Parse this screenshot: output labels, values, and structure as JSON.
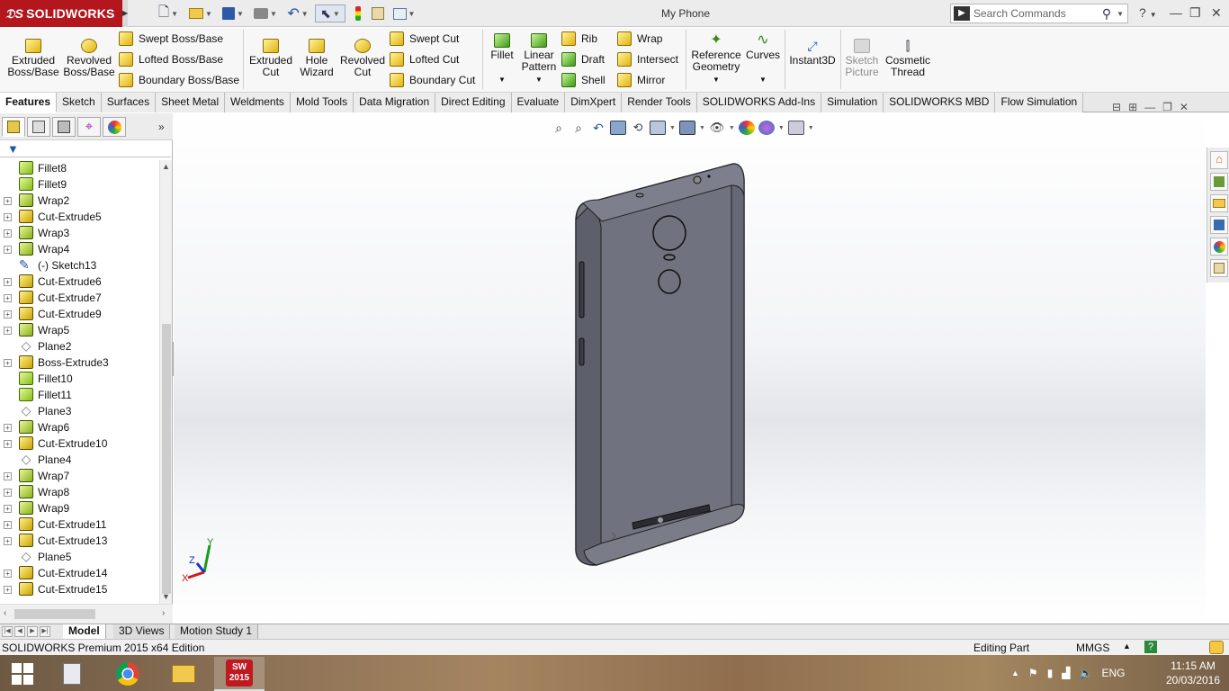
{
  "titlebar": {
    "app_name": "SOLIDWORKS",
    "doc_title": "My Phone",
    "search_placeholder": "Search Commands",
    "help_icon": "?"
  },
  "command_manager": {
    "large_buttons": [
      {
        "label": "Extruded Boss/Base"
      },
      {
        "label": "Revolved Boss/Base"
      },
      {
        "label": "Extruded Cut"
      },
      {
        "label": "Hole Wizard"
      },
      {
        "label": "Revolved Cut"
      },
      {
        "label": "Fillet"
      },
      {
        "label": "Linear Pattern"
      },
      {
        "label": "Reference Geometry"
      },
      {
        "label": "Curves"
      },
      {
        "label": "Instant3D"
      },
      {
        "label": "Sketch Picture"
      },
      {
        "label": "Cosmetic Thread"
      }
    ],
    "small_buttons": [
      {
        "label": "Swept Boss/Base"
      },
      {
        "label": "Lofted Boss/Base"
      },
      {
        "label": "Boundary Boss/Base"
      },
      {
        "label": "Swept Cut"
      },
      {
        "label": "Lofted Cut"
      },
      {
        "label": "Boundary Cut"
      },
      {
        "label": "Rib"
      },
      {
        "label": "Draft"
      },
      {
        "label": "Shell"
      },
      {
        "label": "Wrap"
      },
      {
        "label": "Intersect"
      },
      {
        "label": "Mirror"
      }
    ]
  },
  "tabs": [
    "Features",
    "Sketch",
    "Surfaces",
    "Sheet Metal",
    "Weldments",
    "Mold Tools",
    "Data Migration",
    "Direct Editing",
    "Evaluate",
    "DimXpert",
    "Render Tools",
    "SOLIDWORKS Add-Ins",
    "Simulation",
    "SOLIDWORKS MBD",
    "Flow Simulation"
  ],
  "active_tab": "Features",
  "feature_tree": [
    {
      "label": "Fillet8",
      "type": "fillet",
      "expandable": false
    },
    {
      "label": "Fillet9",
      "type": "fillet",
      "expandable": false
    },
    {
      "label": "Wrap2",
      "type": "wrap",
      "expandable": true
    },
    {
      "label": "Cut-Extrude5",
      "type": "extr",
      "expandable": true
    },
    {
      "label": "Wrap3",
      "type": "wrap",
      "expandable": true
    },
    {
      "label": "Wrap4",
      "type": "wrap",
      "expandable": true
    },
    {
      "label": "(-) Sketch13",
      "type": "sketch",
      "expandable": false
    },
    {
      "label": "Cut-Extrude6",
      "type": "extr",
      "expandable": true
    },
    {
      "label": "Cut-Extrude7",
      "type": "extr",
      "expandable": true
    },
    {
      "label": "Cut-Extrude9",
      "type": "extr",
      "expandable": true
    },
    {
      "label": "Wrap5",
      "type": "wrap",
      "expandable": true
    },
    {
      "label": "Plane2",
      "type": "plane",
      "expandable": false
    },
    {
      "label": "Boss-Extrude3",
      "type": "extr",
      "expandable": true
    },
    {
      "label": "Fillet10",
      "type": "fillet",
      "expandable": false
    },
    {
      "label": "Fillet11",
      "type": "fillet",
      "expandable": false
    },
    {
      "label": "Plane3",
      "type": "plane",
      "expandable": false
    },
    {
      "label": "Wrap6",
      "type": "wrap",
      "expandable": true
    },
    {
      "label": "Cut-Extrude10",
      "type": "extr",
      "expandable": true
    },
    {
      "label": "Plane4",
      "type": "plane",
      "expandable": false
    },
    {
      "label": "Wrap7",
      "type": "wrap",
      "expandable": true
    },
    {
      "label": "Wrap8",
      "type": "wrap",
      "expandable": true
    },
    {
      "label": "Wrap9",
      "type": "wrap",
      "expandable": true
    },
    {
      "label": "Cut-Extrude11",
      "type": "extr",
      "expandable": true
    },
    {
      "label": "Cut-Extrude13",
      "type": "extr",
      "expandable": true
    },
    {
      "label": "Plane5",
      "type": "plane",
      "expandable": false
    },
    {
      "label": "Cut-Extrude14",
      "type": "extr",
      "expandable": true
    },
    {
      "label": "Cut-Extrude15",
      "type": "extr",
      "expandable": true
    }
  ],
  "triad": {
    "x": "X",
    "y": "Y",
    "z": "Z"
  },
  "bottom_tabs": [
    "Model",
    "3D Views",
    "Motion Study 1"
  ],
  "status": {
    "edition": "SOLIDWORKS Premium 2015 x64 Edition",
    "mode": "Editing Part",
    "units": "MMGS"
  },
  "taskbar": {
    "sw_badge": "2015",
    "lang": "ENG",
    "time": "11:15 AM",
    "date": "20/03/2016"
  },
  "colors": {
    "brand": "#b3161d",
    "model_body": "#6a6c79"
  }
}
